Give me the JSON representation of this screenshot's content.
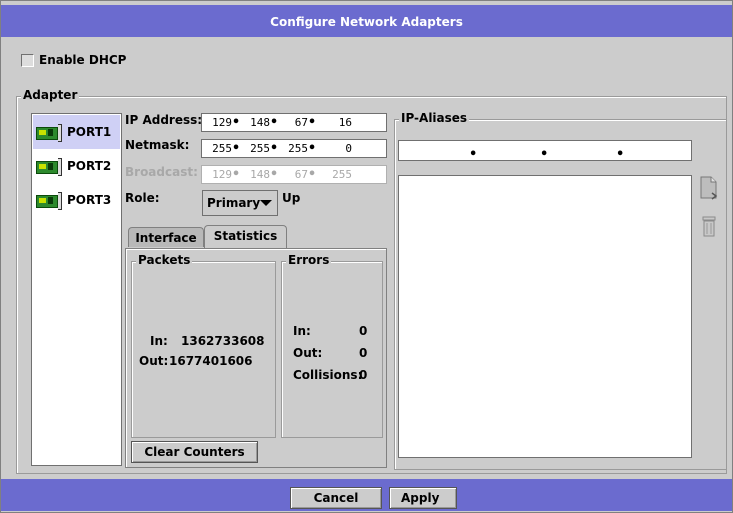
{
  "dialog": {
    "title": "Configure Network Adapters",
    "enable_dhcp_label": "Enable DHCP",
    "enable_dhcp_checked": false
  },
  "adapter": {
    "group_label": "Adapter",
    "ports": [
      {
        "label": "PORT1",
        "selected": true
      },
      {
        "label": "PORT2",
        "selected": false
      },
      {
        "label": "PORT3",
        "selected": false
      }
    ],
    "ip_address_label": "IP Address:",
    "ip_address": [
      "129",
      "148",
      "67",
      "16"
    ],
    "netmask_label": "Netmask:",
    "netmask": [
      "255",
      "255",
      "255",
      "0"
    ],
    "broadcast_label": "Broadcast:",
    "broadcast": [
      "129",
      "148",
      "67",
      "255"
    ],
    "role_label": "Role:",
    "role_value": "Primary",
    "status_text": "Up"
  },
  "tabs": [
    {
      "label": "Interface",
      "active": false
    },
    {
      "label": "Statistics",
      "active": true
    }
  ],
  "statistics": {
    "packets_label": "Packets",
    "packets_in_label": "In:",
    "packets_in": "1362733608",
    "packets_out_label": "Out:",
    "packets_out": "1677401606",
    "errors_label": "Errors",
    "errors_in_label": "In:",
    "errors_in": "0",
    "errors_out_label": "Out:",
    "errors_out": "0",
    "collisions_label": "Collisions:",
    "collisions": "0",
    "clear_counters_label": "Clear Counters"
  },
  "aliases": {
    "group_label": "IP-Aliases",
    "new_icon": "new-document-icon",
    "delete_icon": "trash-icon"
  },
  "footer": {
    "cancel_label": "Cancel",
    "apply_label": "Apply"
  },
  "colors": {
    "titlebar": "#6b6bcf",
    "panel": "#cccccc",
    "selection": "#cfd0f5"
  }
}
